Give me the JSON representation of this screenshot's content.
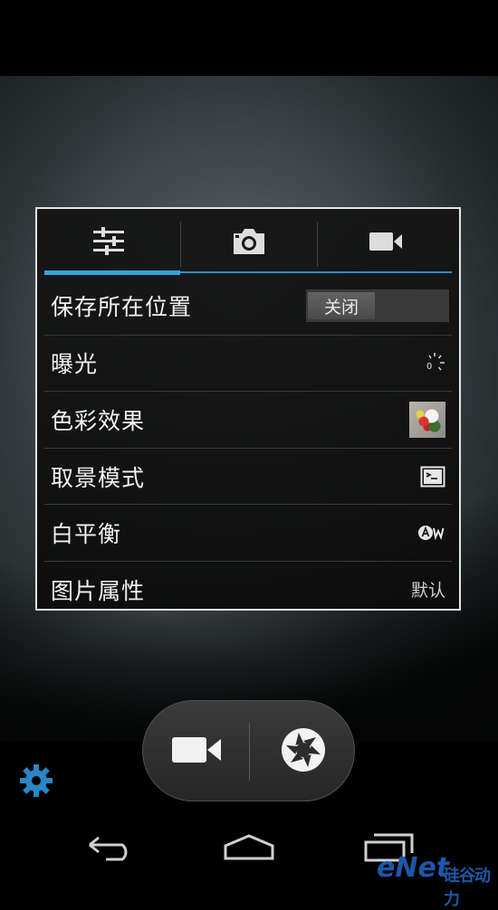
{
  "tabs": [
    {
      "name": "settings-sliders-icon"
    },
    {
      "name": "camera-icon"
    },
    {
      "name": "video-camera-icon"
    }
  ],
  "settings": {
    "storage_location": {
      "label": "保存所在位置",
      "toggle_value": "关闭"
    },
    "exposure": {
      "label": "曝光",
      "value_icon": "exposure-icon",
      "value": "0"
    },
    "color_effect": {
      "label": "色彩效果",
      "value_icon": "color-effect-thumbnail"
    },
    "scene_mode": {
      "label": "取景模式",
      "value_icon": "scene-mode-icon"
    },
    "white_balance": {
      "label": "白平衡",
      "value_icon": "auto-white-balance-icon"
    },
    "picture_properties": {
      "label": "图片属性",
      "value": "默认"
    }
  },
  "controls": {
    "video_mode": "video-camera-icon",
    "shutter": "shutter-icon",
    "settings": "gear-icon"
  },
  "navigation": [
    "back-icon",
    "home-icon",
    "recent-apps-icon"
  ],
  "watermark": {
    "brand": "eNet",
    "cn": "硅谷动力"
  },
  "colors": {
    "accent": "#33a3dc",
    "gear": "#2b86c4",
    "watermark": "#1d57a8"
  }
}
